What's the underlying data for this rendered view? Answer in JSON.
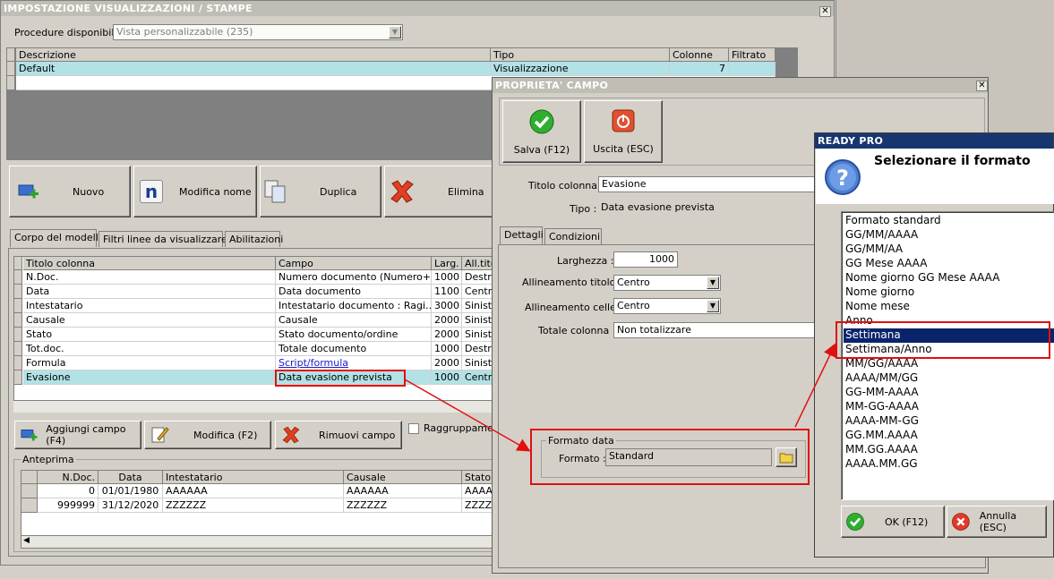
{
  "main_window": {
    "title": "IMPOSTAZIONE VISUALIZZAZIONI / STAMPE",
    "procedure_label": "Procedure disponibili :",
    "procedure_value": "Vista personalizzabile (235)",
    "top_grid": {
      "headers": [
        "Descrizione",
        "Tipo",
        "Colonne",
        "Filtrato"
      ],
      "rows": [
        [
          "Default",
          "Visualizzazione",
          "7",
          ""
        ]
      ]
    },
    "buttons": {
      "nuovo": "Nuovo",
      "modifica_nome": "Modifica nome",
      "duplica": "Duplica",
      "elimina": "Elimina"
    },
    "tabs": [
      "Corpo del modello",
      "Filtri linee da visualizzare",
      "Abilitazioni"
    ],
    "fields_grid": {
      "headers": [
        "Titolo colonna",
        "Campo",
        "Larg.",
        "All.tito"
      ],
      "rows": [
        [
          "N.Doc.",
          "Numero documento (Numero+…",
          "1000",
          "Destra"
        ],
        [
          "Data",
          "Data documento",
          "1100",
          "Centro"
        ],
        [
          "Intestatario",
          "Intestatario documento : Ragi…",
          "3000",
          "Sinistra"
        ],
        [
          "Causale",
          "Causale",
          "2000",
          "Sinistra"
        ],
        [
          "Stato",
          "Stato documento/ordine",
          "2000",
          "Sinistra"
        ],
        [
          "Tot.doc.",
          "Totale documento",
          "1000",
          "Destra"
        ],
        [
          "Formula",
          "Script/formula",
          "2000",
          "Sinistra"
        ],
        [
          "Evasione",
          "Data evasione prevista",
          "1000",
          "Centro"
        ]
      ]
    },
    "field_buttons": {
      "aggiungi": "Aggiungi campo (F4)",
      "modifica": "Modifica (F2)",
      "rimuovi": "Rimuovi campo",
      "raggruppamenti": "Raggruppament"
    },
    "preview": {
      "label": "Anteprima",
      "headers": [
        "N.Doc.",
        "Data",
        "Intestatario",
        "Causale",
        "Stato"
      ],
      "rows": [
        [
          "0",
          "01/01/1980",
          "AAAAAA",
          "AAAAAA",
          "AAAA"
        ],
        [
          "999999",
          "31/12/2020",
          "ZZZZZZ",
          "ZZZZZZ",
          "ZZZZ"
        ]
      ]
    }
  },
  "props_window": {
    "title": "PROPRIETA' CAMPO",
    "salva": "Salva (F12)",
    "uscita": "Uscita (ESC)",
    "titolo_colonna_label": "Titolo colonna :",
    "titolo_colonna_value": "Evasione",
    "tipo_label": "Tipo :",
    "tipo_value": "Data evasione prevista",
    "tabs": [
      "Dettagli",
      "Condizioni"
    ],
    "larghezza_label": "Larghezza :",
    "larghezza_value": "1000",
    "all_titolo_label": "Allineamento titolo :",
    "all_titolo_value": "Centro",
    "all_celle_label": "Allineamento celle :",
    "all_celle_value": "Centro",
    "totale_label": "Totale colonna :",
    "totale_value": "Non totalizzare",
    "formato_group": "Formato data",
    "formato_label": "Formato :",
    "formato_value": "Standard"
  },
  "format_dialog": {
    "title": "READY PRO",
    "heading": "Selezionare il formato",
    "selected_index": 8,
    "options": [
      "Formato standard",
      "GG/MM/AAAA",
      "GG/MM/AA",
      "GG Mese AAAA",
      "Nome giorno GG Mese AAAA",
      "Nome giorno",
      "Nome mese",
      "Anno",
      "Settimana",
      "Settimana/Anno",
      "MM/GG/AAAA",
      "AAAA/MM/GG",
      "GG-MM-AAAA",
      "MM-GG-AAAA",
      "AAAA-MM-GG",
      "GG.MM.AAAA",
      "MM.GG.AAAA",
      "AAAA.MM.GG"
    ],
    "ok": "OK (F12)",
    "annulla": "Annulla (ESC)"
  },
  "colors": {
    "selection_row": "#b2e1e6",
    "highlight": "#0a246a",
    "annotation_red": "#e01010"
  }
}
